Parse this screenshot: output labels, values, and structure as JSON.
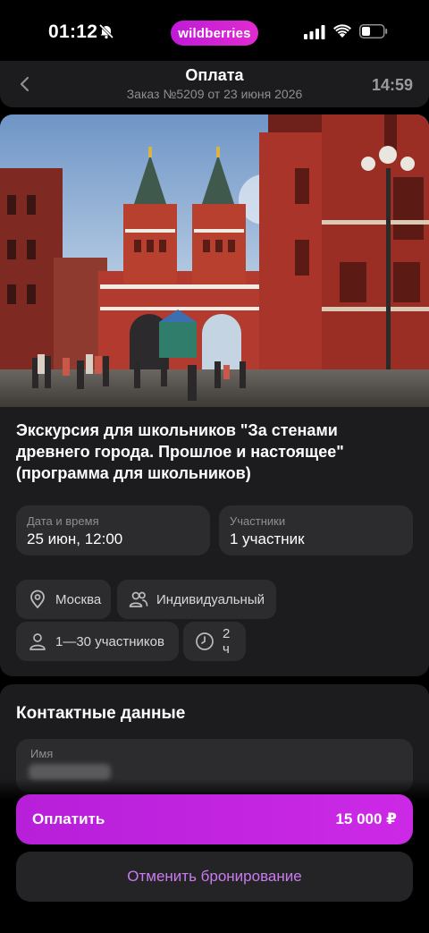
{
  "status_bar": {
    "time": "01:12",
    "brand": "wildberries",
    "icons": [
      "bell-off-icon",
      "signal-icon",
      "wifi-icon",
      "battery-icon"
    ]
  },
  "header": {
    "title": "Оплата",
    "subtitle": "Заказ №5209 от 23 июня 2026",
    "timer": "14:59",
    "back_icon": "chevron-left-icon"
  },
  "tour": {
    "title": "Экскурсия для школьников \"За стенами древнего города. Прошлое и настоящее\" (программа для школьников)",
    "date_label": "Дата и время",
    "date_value": "25 июн, 12:00",
    "participants_label": "Участники",
    "participants_value": "1 участник",
    "chips": {
      "city": "Москва",
      "type": "Индивидуальный",
      "group_size": "1—30 участников",
      "duration": "2 ч"
    }
  },
  "contacts": {
    "title": "Контактные данные",
    "name_label": "Имя"
  },
  "actions": {
    "pay_label": "Оплатить",
    "pay_amount": "15 000 ₽",
    "cancel_label": "Отменить бронирование"
  },
  "colors": {
    "accent": "#cb2ae4",
    "cancel_text": "#c97cf0",
    "card_bg": "#1c1c1e",
    "field_bg": "#2c2c2e"
  }
}
